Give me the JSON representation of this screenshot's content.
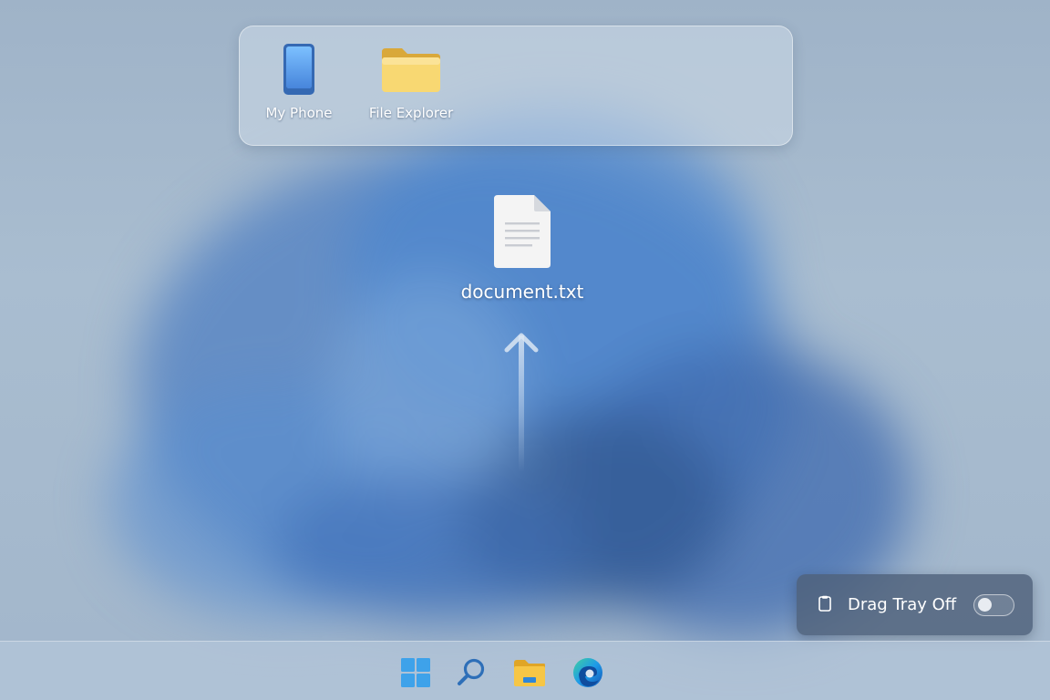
{
  "drop_tray": {
    "targets": [
      {
        "label": "My Phone",
        "icon": "phone-icon"
      },
      {
        "label": "File Explorer",
        "icon": "folder-icon"
      }
    ]
  },
  "dragged_file": {
    "name": "document.txt",
    "icon": "text-file-icon"
  },
  "drag_toggle": {
    "label": "Drag Tray Off",
    "state": "off",
    "icon": "clipboard-icon"
  },
  "taskbar": {
    "items": [
      {
        "icon": "windows-start-icon"
      },
      {
        "icon": "search-icon"
      },
      {
        "icon": "file-explorer-icon"
      },
      {
        "icon": "edge-browser-icon"
      }
    ]
  },
  "colors": {
    "wallpaper_accent": "#4f7fc2",
    "folder_yellow": "#f6d46a",
    "phone_blue": "#4f8fe0",
    "start_blue": "#3fa4ea"
  }
}
